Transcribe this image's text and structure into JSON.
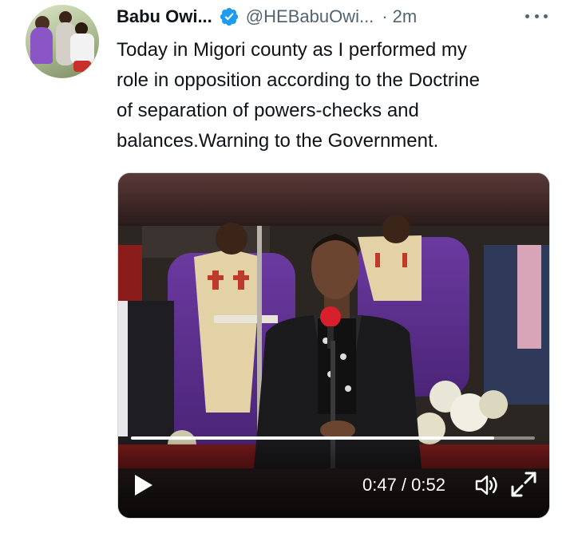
{
  "author": {
    "name": "Babu Owi...",
    "handle": "@HEBabuOwi...",
    "separator": "·",
    "time": "2m",
    "verified": true
  },
  "tweet": {
    "text": "Today in Migori county as I performed my\nrole in opposition according to the Doctrine\nof separation of powers-checks and\nbalances.Warning to the Government."
  },
  "video": {
    "current_time": "0:47",
    "duration": "0:52",
    "time_readout": "0:47 / 0:52",
    "progress_fraction": 0.9
  },
  "icons": {
    "verified": "verified-badge-icon",
    "more": "more-options-icon",
    "play": "play-icon",
    "volume": "volume-icon",
    "fullscreen": "fullscreen-icon"
  },
  "colors": {
    "verified_blue": "#1d9bf0",
    "secondary_text": "#536471",
    "primary_text": "#0f1419",
    "card_border": "#cfd9de"
  }
}
